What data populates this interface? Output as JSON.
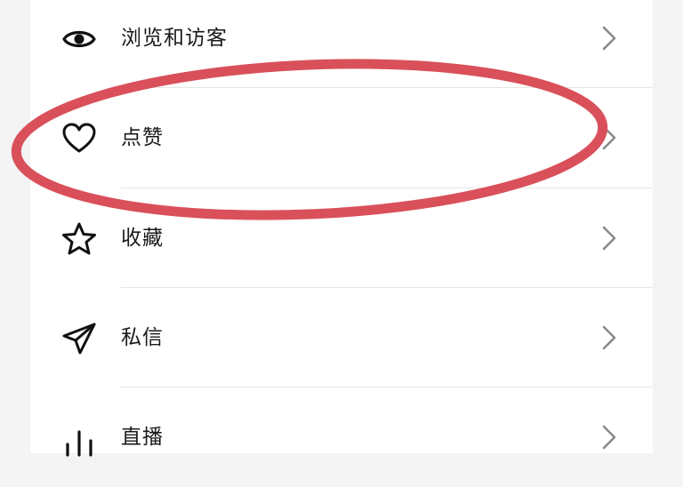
{
  "menu": {
    "items": [
      {
        "label": "浏览和访客",
        "icon": "eye-icon"
      },
      {
        "label": "点赞",
        "icon": "heart-icon"
      },
      {
        "label": "收藏",
        "icon": "star-icon"
      },
      {
        "label": "私信",
        "icon": "paper-plane-icon"
      },
      {
        "label": "直播",
        "icon": "bar-chart-icon"
      }
    ]
  },
  "colors": {
    "annotation": "#d9505a",
    "text": "#1a1a1a",
    "chevron": "#8a8a8a",
    "divider": "#e6e6e6"
  }
}
